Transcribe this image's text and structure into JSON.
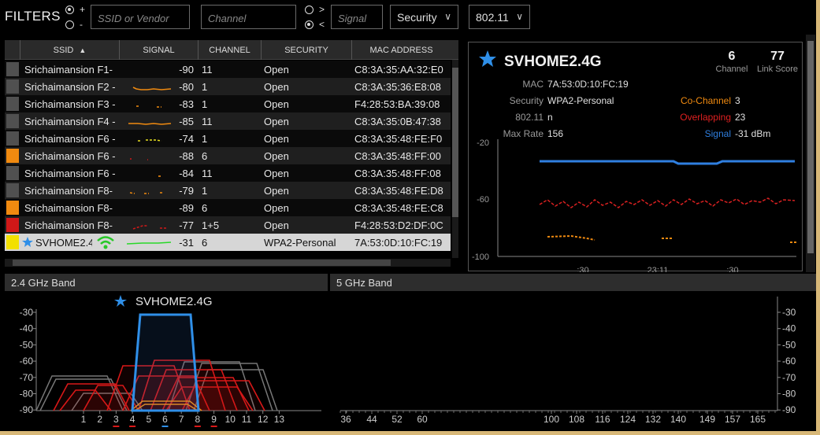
{
  "filters": {
    "title": "FILTERS",
    "plus_label": "+",
    "minus_label": "-",
    "gt_label": ">",
    "lt_label": "<",
    "ssid_placeholder": "SSID or Vendor",
    "channel_placeholder": "Channel",
    "signal_placeholder": "Signal",
    "security_label": "Security",
    "mode_label": "802.11"
  },
  "table": {
    "headers": [
      "SSID",
      "SIGNAL",
      "CHANNEL",
      "SECURITY",
      "MAC ADDRESS"
    ],
    "rows": [
      {
        "ssid": "Srichaimansion F1-",
        "signal": "-90",
        "channel": "11",
        "security": "Open",
        "mac": "C8:3A:35:AA:32:E0",
        "color": "#505050"
      },
      {
        "ssid": "Srichaimansion F2 -",
        "signal": "-80",
        "channel": "1",
        "security": "Open",
        "mac": "C8:3A:35:36:E8:08",
        "color": "#505050"
      },
      {
        "ssid": "Srichaimansion F3 -",
        "signal": "-83",
        "channel": "1",
        "security": "Open",
        "mac": "F4:28:53:BA:39:08",
        "color": "#505050"
      },
      {
        "ssid": "Srichaimansion F4 -",
        "signal": "-85",
        "channel": "11",
        "security": "Open",
        "mac": "C8:3A:35:0B:47:38",
        "color": "#505050"
      },
      {
        "ssid": "Srichaimansion F6 -",
        "signal": "-74",
        "channel": "1",
        "security": "Open",
        "mac": "C8:3A:35:48:FE:F0",
        "color": "#505050"
      },
      {
        "ssid": "Srichaimansion F6 -",
        "signal": "-88",
        "channel": "6",
        "security": "Open",
        "mac": "C8:3A:35:48:FF:00",
        "color": "#f08a10"
      },
      {
        "ssid": "Srichaimansion F6 -",
        "signal": "-84",
        "channel": "11",
        "security": "Open",
        "mac": "C8:3A:35:48:FF:08",
        "color": "#505050"
      },
      {
        "ssid": "Srichaimansion F8-",
        "signal": "-79",
        "channel": "1",
        "security": "Open",
        "mac": "C8:3A:35:48:FE:D8",
        "color": "#505050"
      },
      {
        "ssid": "Srichaimansion F8-",
        "signal": "-89",
        "channel": "6",
        "security": "Open",
        "mac": "C8:3A:35:48:FE:C8",
        "color": "#f08a10"
      },
      {
        "ssid": "Srichaimansion F8-",
        "signal": "-77",
        "channel": "1+5",
        "security": "Open",
        "mac": "F4:28:53:D2:DF:0C",
        "color": "#d01818"
      },
      {
        "ssid": "SVHOME2.4",
        "signal": "-31",
        "channel": "6",
        "security": "WPA2-Personal",
        "mac": "7A:53:0D:10:FC:19",
        "color": "#f2e000",
        "selected": true
      }
    ]
  },
  "detail": {
    "ssid": "SVHOME2.4G",
    "channel_value": "6",
    "channel_label": "Channel",
    "link_score_value": "77",
    "link_score_label": "Link Score",
    "mac_label": "MAC",
    "mac_value": "7A:53:0D:10:FC:19",
    "security_label": "Security",
    "security_value": "WPA2-Personal",
    "mode_label": "802.11",
    "mode_value": "n",
    "maxrate_label": "Max Rate",
    "maxrate_value": "156",
    "cochannel_label": "Co-Channel",
    "cochannel_value": "3",
    "overlapping_label": "Overlapping",
    "overlapping_value": "23",
    "signal_label": "Signal",
    "signal_value": "-31 dBm",
    "y_ticks": [
      "-20",
      "-60",
      "-100"
    ],
    "x_ticks": [
      ":30",
      "23:11",
      ":30"
    ],
    "colors": {
      "signal": "#2f7fe0",
      "overlap": "#e02020",
      "cochannel": "#f08a10"
    }
  },
  "band24": {
    "title": "2.4 GHz Band",
    "ssid": "SVHOME2.4G",
    "y_ticks": [
      "-30",
      "-40",
      "-50",
      "-60",
      "-70",
      "-80",
      "-90"
    ],
    "x_ticks": [
      "1",
      "2",
      "3",
      "4",
      "5",
      "6",
      "7",
      "8",
      "9",
      "10",
      "11",
      "12",
      "13"
    ]
  },
  "band5": {
    "title": "5 GHz Band",
    "y_ticks": [
      "-30",
      "-40",
      "-50",
      "-60",
      "-70",
      "-80",
      "-90"
    ],
    "x_ticks": [
      "36",
      "44",
      "52",
      "60",
      "100",
      "108",
      "116",
      "124",
      "132",
      "140",
      "149",
      "157",
      "165"
    ]
  }
}
